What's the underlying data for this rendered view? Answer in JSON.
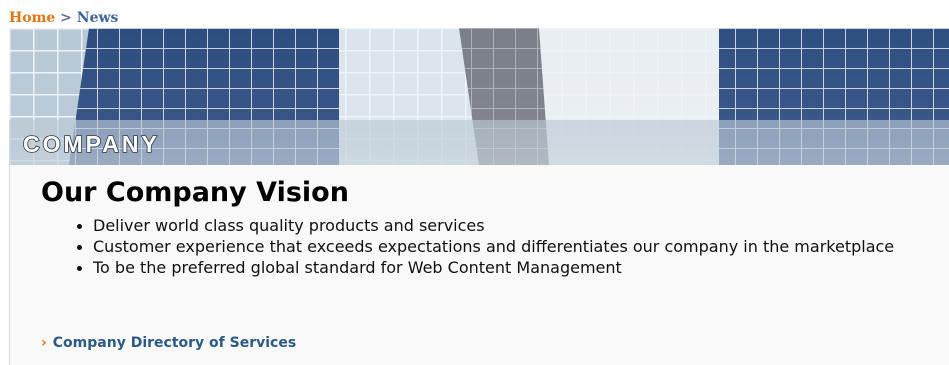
{
  "breadcrumb": {
    "home": "Home",
    "separator": ">",
    "current": "News"
  },
  "banner": {
    "label": "COMPANY"
  },
  "page": {
    "title": "Our Company Vision"
  },
  "vision_items": [
    "Deliver world class quality products and services",
    "Customer experience that exceeds expectations and differentiates our company in the marketplace",
    "To be the preferred global standard for Web Content Management"
  ],
  "links": {
    "arrow": "›",
    "directory": "Company Directory of Services"
  },
  "colors": {
    "breadcrumb_home": "#e87411",
    "breadcrumb_current": "#3a62a8",
    "link": "#2b5a8a",
    "arrow": "#e87411"
  }
}
